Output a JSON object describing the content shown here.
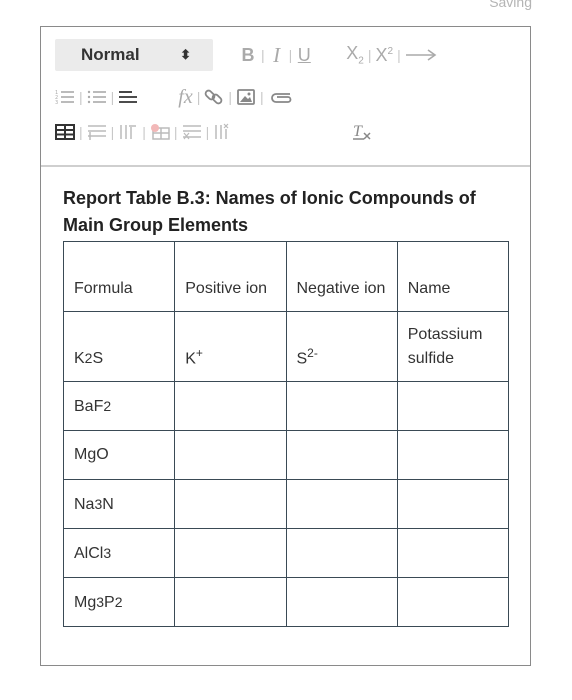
{
  "status": {
    "text": "Saving"
  },
  "toolbar": {
    "format": {
      "selected": "Normal"
    },
    "bold": "B",
    "italic": "I",
    "underline": "U",
    "subscript": {
      "base": "X",
      "mark": "2"
    },
    "superscript": {
      "base": "X",
      "mark": "2"
    },
    "formula": "fx"
  },
  "report": {
    "title": "Report Table B.3: Names of Ionic Compounds of Main Group Elements",
    "columns": [
      "Formula",
      "Positive ion",
      "Negative ion",
      "Name"
    ],
    "rows": [
      {
        "formula": {
          "a": "K",
          "a_sub": "2",
          "b": "S",
          "b_sub": "",
          "c": "",
          "c_sub": ""
        },
        "positive": {
          "base": "K",
          "charge": "+"
        },
        "negative": {
          "base": "S",
          "charge": "2-"
        },
        "name": "Potassium sulfide"
      },
      {
        "formula": {
          "a": "BaF",
          "a_sub": "2",
          "b": "",
          "b_sub": "",
          "c": "",
          "c_sub": ""
        },
        "positive": {
          "base": "",
          "charge": ""
        },
        "negative": {
          "base": "",
          "charge": ""
        },
        "name": ""
      },
      {
        "formula": {
          "a": "MgO",
          "a_sub": "",
          "b": "",
          "b_sub": "",
          "c": "",
          "c_sub": ""
        },
        "positive": {
          "base": "",
          "charge": ""
        },
        "negative": {
          "base": "",
          "charge": ""
        },
        "name": ""
      },
      {
        "formula": {
          "a": "Na",
          "a_sub": "3",
          "b": "N",
          "b_sub": "",
          "c": "",
          "c_sub": ""
        },
        "positive": {
          "base": "",
          "charge": ""
        },
        "negative": {
          "base": "",
          "charge": ""
        },
        "name": ""
      },
      {
        "formula": {
          "a": "AlCl",
          "a_sub": "3",
          "b": "",
          "b_sub": "",
          "c": "",
          "c_sub": ""
        },
        "positive": {
          "base": "",
          "charge": ""
        },
        "negative": {
          "base": "",
          "charge": ""
        },
        "name": ""
      },
      {
        "formula": {
          "a": "Mg",
          "a_sub": "3",
          "b": "P",
          "b_sub": "2",
          "c": "",
          "c_sub": ""
        },
        "positive": {
          "base": "",
          "charge": ""
        },
        "negative": {
          "base": "",
          "charge": ""
        },
        "name": ""
      }
    ]
  },
  "colors": {
    "text": "#222222",
    "icon": "#aaaaaa",
    "table_border": "#3a4a55",
    "select_bg": "#ebebeb"
  }
}
